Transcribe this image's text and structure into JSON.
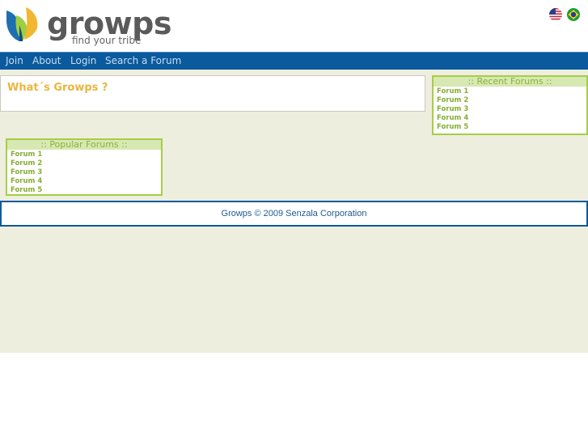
{
  "header": {
    "logo_text": "growps",
    "tagline": "find your tribe",
    "languages": [
      {
        "name": "English",
        "icon": "us-flag-icon"
      },
      {
        "name": "Portuguese",
        "icon": "brazil-flag-icon"
      }
    ]
  },
  "nav": {
    "items": [
      {
        "label": "Join"
      },
      {
        "label": "About"
      },
      {
        "label": "Login"
      },
      {
        "label": "Search a Forum"
      }
    ]
  },
  "main": {
    "whats_title": "What´s Growps ?"
  },
  "recent_forums": {
    "title": ":: Recent Forums ::",
    "items": [
      "Forum 1",
      "Forum 2",
      "Forum 3",
      "Forum 4",
      "Forum 5"
    ]
  },
  "popular_forums": {
    "title": ":: Popular Forums ::",
    "items": [
      "Forum 1",
      "Forum 2",
      "Forum 3",
      "Forum 4",
      "Forum 5"
    ]
  },
  "footer": {
    "text": "Growps © 2009 Senzala Corporation"
  },
  "colors": {
    "nav_bg": "#0b5a9e",
    "content_bg": "#eeeedf",
    "accent_yellow": "#e9b640",
    "accent_green": "#a6ce46"
  }
}
